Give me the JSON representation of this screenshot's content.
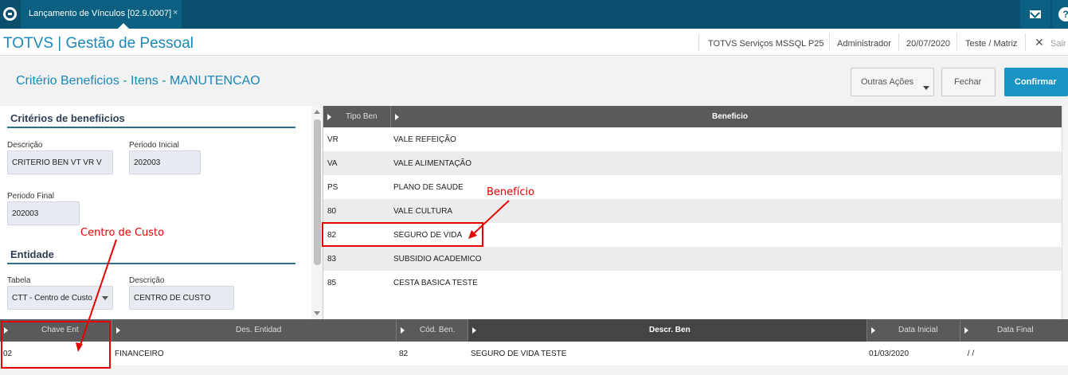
{
  "topbar": {
    "tab_label": "Lançamento de Vínculos [02.9.0007]",
    "tab_close": "×",
    "help_glyph": "?"
  },
  "appbar": {
    "title": "TOTVS | Gestão de Pessoal",
    "server": "TOTVS Serviços MSSQL P25",
    "user": "Administrador",
    "date": "20/07/2020",
    "branch": "Teste / Matriz",
    "exit_label": "Sair"
  },
  "toolbar": {
    "page_title": "Critério Beneficios - Itens - MANUTENCAO",
    "other_actions": "Outras Ações",
    "close": "Fechar",
    "confirm": "Confirmar"
  },
  "criteria": {
    "section_title": "Critérios de benefíicios",
    "descricao_label": "Descrição",
    "descricao_value": "CRITERIO BEN VT VR V",
    "periodo_inicial_label": "Periodo Inicial",
    "periodo_inicial_value": "202003",
    "periodo_final_label": "Periodo Final",
    "periodo_final_value": "202003"
  },
  "entity": {
    "section_title": "Entidade",
    "tabela_label": "Tabela",
    "tabela_value": "CTT - Centro de Custo",
    "descricao_label": "Descrição",
    "descricao_value": "CENTRO DE CUSTO"
  },
  "benefit_grid": {
    "headers": [
      "Tipo Ben",
      "Beneficio"
    ],
    "rows": [
      {
        "code": "VR",
        "name": "VALE REFEIÇÃO"
      },
      {
        "code": "VA",
        "name": "VALE ALIMENTAÇÃO"
      },
      {
        "code": "PS",
        "name": "PLANO DE SAUDE"
      },
      {
        "code": "80",
        "name": "VALE CULTURA"
      },
      {
        "code": "82",
        "name": "SEGURO DE VIDA"
      },
      {
        "code": "83",
        "name": "SUBSIDIO ACADEMICO"
      },
      {
        "code": "85",
        "name": "CESTA BASICA TESTE"
      }
    ]
  },
  "bottom_grid": {
    "headers": [
      "Chave Ent",
      "Des. Entidad",
      "Cód. Ben.",
      "Descr. Ben",
      "Data Inicial",
      "Data Final"
    ],
    "rows": [
      {
        "chave": "02",
        "entidade": "FINANCEIRO",
        "cod_ben": "82",
        "descr_ben": "SEGURO DE VIDA TESTE",
        "data_inicial": "01/03/2020",
        "data_final": " / /"
      }
    ]
  },
  "annotations": {
    "benefit_label": "Benefício",
    "cost_center_label": "Centro de Custo"
  },
  "colors": {
    "top_bar": "#0a4f6b",
    "accent": "#1a88b8",
    "confirm_button": "#1a94c4",
    "annotation_red": "#e60000"
  }
}
